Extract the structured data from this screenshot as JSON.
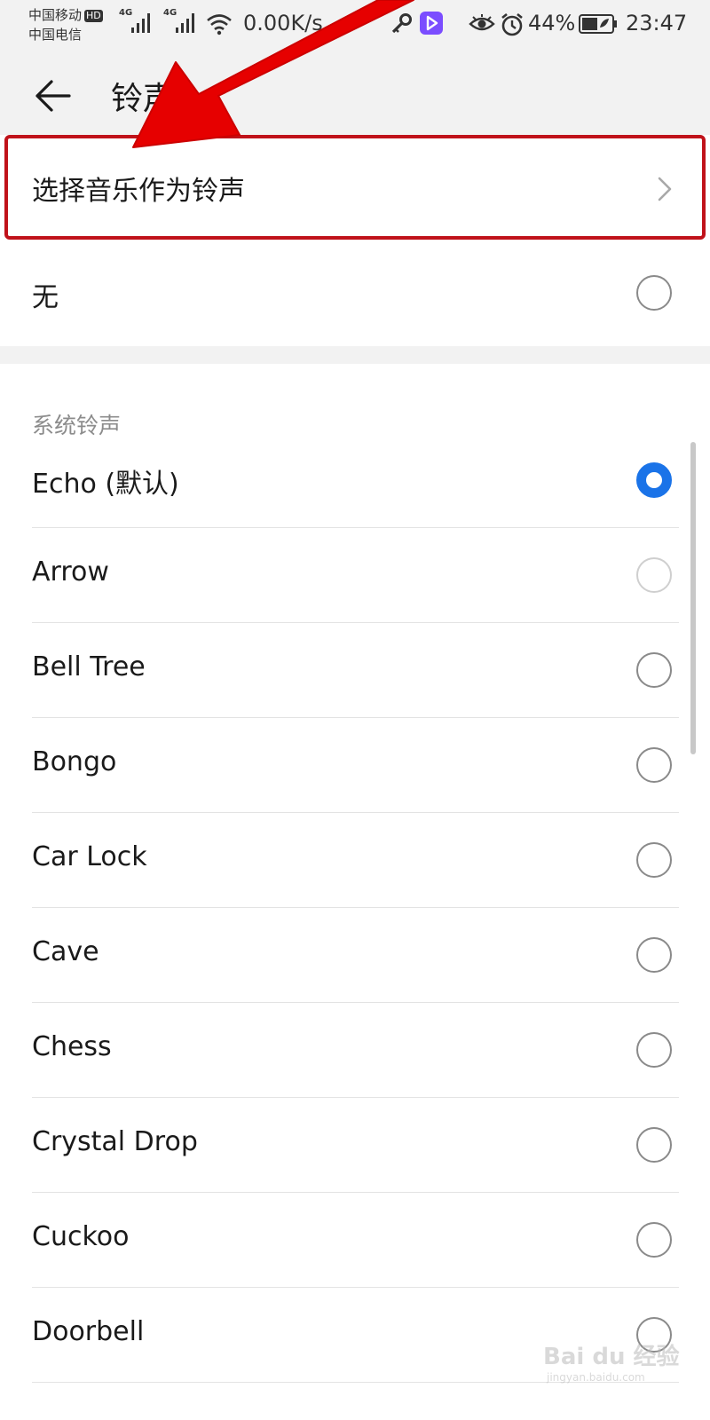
{
  "status_bar": {
    "carrier_1": "中国移动",
    "carrier_1_badge": "HD",
    "carrier_2": "中国电信",
    "signal_1_tag": "4G",
    "signal_2_tag": "4G",
    "net_speed": "0.00K/s",
    "battery_percent": "44%",
    "time": "23:47",
    "icons": [
      "signal-icon",
      "wifi-icon",
      "key-icon",
      "video-app-icon",
      "eye-icon",
      "alarm-icon",
      "battery-icon"
    ]
  },
  "header": {
    "back_icon": "back-arrow-icon",
    "title": "铃声"
  },
  "top_options": {
    "choose_music_label": "选择音乐作为铃声",
    "none_label": "无",
    "none_selected": false
  },
  "system_ringtones": {
    "heading": "系统铃声",
    "selected_index": 0,
    "items": [
      {
        "label": "Echo (默认)"
      },
      {
        "label": "Arrow"
      },
      {
        "label": "Bell Tree"
      },
      {
        "label": "Bongo"
      },
      {
        "label": "Car Lock"
      },
      {
        "label": "Cave"
      },
      {
        "label": "Chess"
      },
      {
        "label": "Crystal Drop"
      },
      {
        "label": "Cuckoo"
      },
      {
        "label": "Doorbell"
      }
    ]
  },
  "colors": {
    "accent": "#1a73e8",
    "highlight_border": "#c0121a",
    "annotation_arrow": "#e60000"
  },
  "watermark": {
    "brand": "Bai du 经验",
    "url": "jingyan.baidu.com"
  }
}
